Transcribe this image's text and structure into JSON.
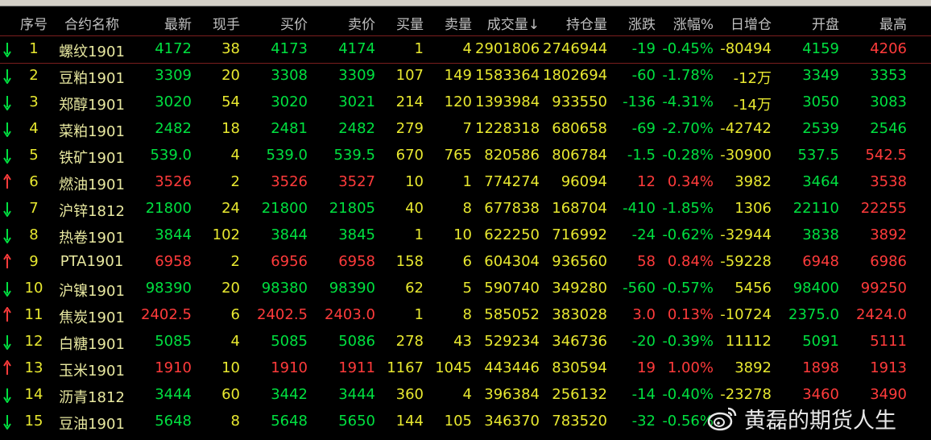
{
  "colors": {
    "up": "#ff3b3b",
    "down": "#00e040",
    "neutral": "#e8e830",
    "header": "#c0c0c0",
    "name": "#e8e8a0"
  },
  "headers": [
    "序号",
    "合约名称",
    "最新",
    "现手",
    "买价",
    "卖价",
    "买量",
    "卖量",
    "成交量↓",
    "持仓量",
    "涨跌",
    "涨幅%",
    "日增仓",
    "开盘",
    "最高"
  ],
  "rows": [
    {
      "idx": "1",
      "name": "螺纹1901",
      "last": "4172",
      "vol_now": "38",
      "bid": "4173",
      "ask": "4174",
      "bid_qty": "1",
      "ask_qty": "4",
      "volume": "2901806",
      "oi": "2746944",
      "chg": "-19",
      "chg_pct": "-0.45%",
      "oi_chg": "-80494",
      "open": "4159",
      "high": "4206",
      "dir": "down",
      "last_c": "down",
      "bid_c": "down",
      "ask_c": "down",
      "open_c": "down",
      "high_c": "up"
    },
    {
      "idx": "2",
      "name": "豆粕1901",
      "last": "3309",
      "vol_now": "20",
      "bid": "3308",
      "ask": "3309",
      "bid_qty": "107",
      "ask_qty": "149",
      "volume": "1583364",
      "oi": "1802694",
      "chg": "-60",
      "chg_pct": "-1.78%",
      "oi_chg": "-12万",
      "open": "3349",
      "high": "3353",
      "dir": "down",
      "last_c": "down",
      "bid_c": "down",
      "ask_c": "down",
      "open_c": "down",
      "high_c": "down"
    },
    {
      "idx": "3",
      "name": "郑醇1901",
      "last": "3020",
      "vol_now": "54",
      "bid": "3020",
      "ask": "3021",
      "bid_qty": "214",
      "ask_qty": "120",
      "volume": "1393984",
      "oi": "933550",
      "chg": "-136",
      "chg_pct": "-4.31%",
      "oi_chg": "-14万",
      "open": "3050",
      "high": "3083",
      "dir": "down",
      "last_c": "down",
      "bid_c": "down",
      "ask_c": "down",
      "open_c": "down",
      "high_c": "down"
    },
    {
      "idx": "4",
      "name": "菜粕1901",
      "last": "2482",
      "vol_now": "18",
      "bid": "2481",
      "ask": "2482",
      "bid_qty": "279",
      "ask_qty": "7",
      "volume": "1228318",
      "oi": "680658",
      "chg": "-69",
      "chg_pct": "-2.70%",
      "oi_chg": "-42742",
      "open": "2539",
      "high": "2546",
      "dir": "down",
      "last_c": "down",
      "bid_c": "down",
      "ask_c": "down",
      "open_c": "down",
      "high_c": "down"
    },
    {
      "idx": "5",
      "name": "铁矿1901",
      "last": "539.0",
      "vol_now": "4",
      "bid": "539.0",
      "ask": "539.5",
      "bid_qty": "670",
      "ask_qty": "765",
      "volume": "820586",
      "oi": "806784",
      "chg": "-1.5",
      "chg_pct": "-0.28%",
      "oi_chg": "-30900",
      "open": "537.5",
      "high": "542.5",
      "dir": "down",
      "last_c": "down",
      "bid_c": "down",
      "ask_c": "down",
      "open_c": "down",
      "high_c": "up"
    },
    {
      "idx": "6",
      "name": "燃油1901",
      "last": "3526",
      "vol_now": "2",
      "bid": "3526",
      "ask": "3527",
      "bid_qty": "10",
      "ask_qty": "1",
      "volume": "774274",
      "oi": "96094",
      "chg": "12",
      "chg_pct": "0.34%",
      "oi_chg": "3982",
      "open": "3464",
      "high": "3538",
      "dir": "up",
      "last_c": "up",
      "bid_c": "up",
      "ask_c": "up",
      "open_c": "down",
      "high_c": "up"
    },
    {
      "idx": "7",
      "name": "沪锌1812",
      "last": "21800",
      "vol_now": "24",
      "bid": "21800",
      "ask": "21805",
      "bid_qty": "40",
      "ask_qty": "8",
      "volume": "677838",
      "oi": "168704",
      "chg": "-410",
      "chg_pct": "-1.85%",
      "oi_chg": "1306",
      "open": "22110",
      "high": "22255",
      "dir": "down",
      "last_c": "down",
      "bid_c": "down",
      "ask_c": "down",
      "open_c": "down",
      "high_c": "up"
    },
    {
      "idx": "8",
      "name": "热卷1901",
      "last": "3844",
      "vol_now": "102",
      "bid": "3844",
      "ask": "3845",
      "bid_qty": "1",
      "ask_qty": "10",
      "volume": "622250",
      "oi": "716992",
      "chg": "-24",
      "chg_pct": "-0.62%",
      "oi_chg": "-32944",
      "open": "3838",
      "high": "3892",
      "dir": "down",
      "last_c": "down",
      "bid_c": "down",
      "ask_c": "down",
      "open_c": "down",
      "high_c": "up"
    },
    {
      "idx": "9",
      "name": "PTA1901",
      "last": "6958",
      "vol_now": "2",
      "bid": "6956",
      "ask": "6958",
      "bid_qty": "158",
      "ask_qty": "6",
      "volume": "604304",
      "oi": "936560",
      "chg": "58",
      "chg_pct": "0.84%",
      "oi_chg": "-59228",
      "open": "6948",
      "high": "6986",
      "dir": "up",
      "last_c": "up",
      "bid_c": "up",
      "ask_c": "up",
      "open_c": "up",
      "high_c": "up"
    },
    {
      "idx": "10",
      "name": "沪镍1901",
      "last": "98390",
      "vol_now": "20",
      "bid": "98380",
      "ask": "98390",
      "bid_qty": "62",
      "ask_qty": "5",
      "volume": "590740",
      "oi": "349280",
      "chg": "-560",
      "chg_pct": "-0.57%",
      "oi_chg": "5456",
      "open": "98400",
      "high": "99250",
      "dir": "down",
      "last_c": "down",
      "bid_c": "down",
      "ask_c": "down",
      "open_c": "down",
      "high_c": "up"
    },
    {
      "idx": "11",
      "name": "焦炭1901",
      "last": "2402.5",
      "vol_now": "6",
      "bid": "2402.5",
      "ask": "2403.0",
      "bid_qty": "1",
      "ask_qty": "8",
      "volume": "585052",
      "oi": "383028",
      "chg": "3.0",
      "chg_pct": "0.13%",
      "oi_chg": "-10724",
      "open": "2375.0",
      "high": "2424.0",
      "dir": "up",
      "last_c": "up",
      "bid_c": "up",
      "ask_c": "up",
      "open_c": "down",
      "high_c": "up"
    },
    {
      "idx": "12",
      "name": "白糖1901",
      "last": "5085",
      "vol_now": "4",
      "bid": "5085",
      "ask": "5086",
      "bid_qty": "278",
      "ask_qty": "43",
      "volume": "529234",
      "oi": "346736",
      "chg": "-20",
      "chg_pct": "-0.39%",
      "oi_chg": "11112",
      "open": "5091",
      "high": "5111",
      "dir": "down",
      "last_c": "down",
      "bid_c": "down",
      "ask_c": "down",
      "open_c": "down",
      "high_c": "up"
    },
    {
      "idx": "13",
      "name": "玉米1901",
      "last": "1910",
      "vol_now": "10",
      "bid": "1910",
      "ask": "1911",
      "bid_qty": "1167",
      "ask_qty": "1045",
      "volume": "443446",
      "oi": "830594",
      "chg": "19",
      "chg_pct": "1.00%",
      "oi_chg": "3892",
      "open": "1898",
      "high": "1913",
      "dir": "up",
      "last_c": "up",
      "bid_c": "up",
      "ask_c": "up",
      "open_c": "up",
      "high_c": "up"
    },
    {
      "idx": "14",
      "name": "沥青1812",
      "last": "3444",
      "vol_now": "60",
      "bid": "3442",
      "ask": "3444",
      "bid_qty": "360",
      "ask_qty": "4",
      "volume": "396384",
      "oi": "256132",
      "chg": "-14",
      "chg_pct": "-0.40%",
      "oi_chg": "-23278",
      "open": "3460",
      "high": "3490",
      "dir": "down",
      "last_c": "down",
      "bid_c": "down",
      "ask_c": "down",
      "open_c": "up",
      "high_c": "up"
    },
    {
      "idx": "15",
      "name": "豆油1901",
      "last": "5648",
      "vol_now": "8",
      "bid": "5648",
      "ask": "5650",
      "bid_qty": "144",
      "ask_qty": "105",
      "volume": "346370",
      "oi": "783520",
      "chg": "-32",
      "chg_pct": "-0.56%",
      "oi_chg": "",
      "open": "",
      "high": "",
      "dir": "down",
      "last_c": "down",
      "bid_c": "down",
      "ask_c": "down",
      "open_c": "down",
      "high_c": "down"
    }
  ],
  "watermark": {
    "text": "黄磊的期货人生"
  }
}
